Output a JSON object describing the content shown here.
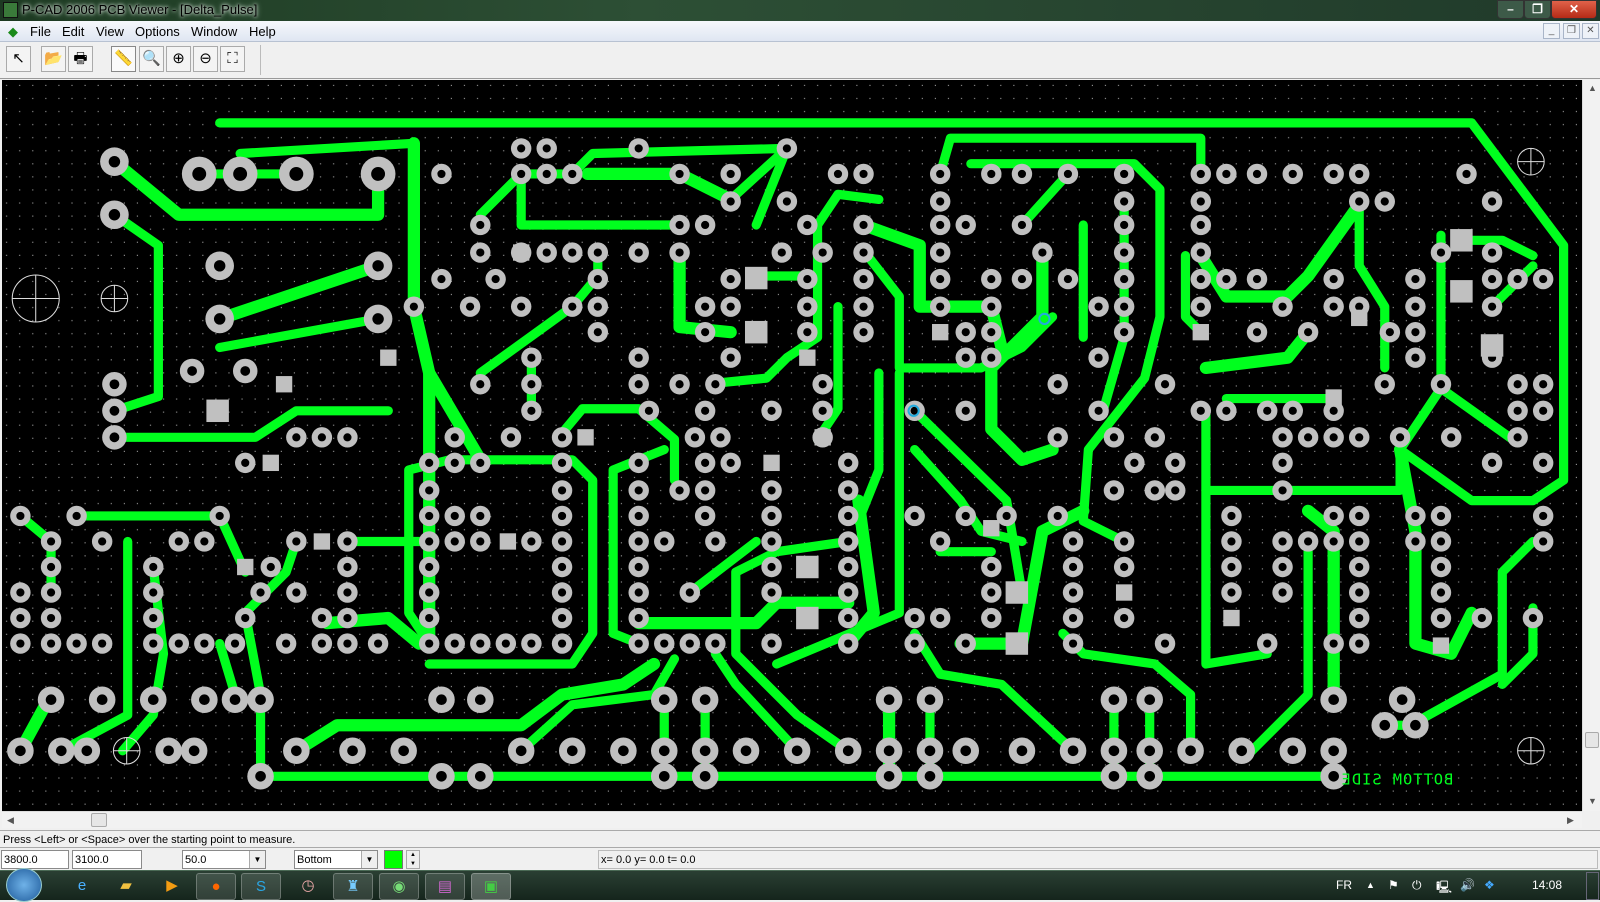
{
  "window": {
    "title": "P-CAD 2006 PCB Viewer - [Delta_Pulse]"
  },
  "menu": [
    "File",
    "Edit",
    "View",
    "Options",
    "Window",
    "Help"
  ],
  "toolbar": [
    {
      "name": "select-tool",
      "icon": "arrow-pointer-icon",
      "glyph": "↖"
    },
    {
      "name": "open-button",
      "icon": "folder-open-icon",
      "glyph": "📂"
    },
    {
      "name": "print-button",
      "icon": "printer-icon",
      "glyph": "🖶"
    },
    {
      "name": "measure-tool",
      "icon": "ruler-icon",
      "glyph": "📏"
    },
    {
      "name": "zoom-window-button",
      "icon": "zoom-window-icon",
      "glyph": "🔍"
    },
    {
      "name": "zoom-in-button",
      "icon": "zoom-in-icon",
      "glyph": "⊕"
    },
    {
      "name": "zoom-out-button",
      "icon": "zoom-out-icon",
      "glyph": "⊖"
    },
    {
      "name": "zoom-extents-button",
      "icon": "zoom-extents-icon",
      "glyph": "⛶"
    }
  ],
  "board": {
    "layer_label": "BOTTOM SIDE",
    "trace_color": "#00ff1e",
    "pad_color": "#c0c0c0",
    "background": "#000000"
  },
  "status": {
    "message": "Press <Left> or <Space> over the starting point to measure."
  },
  "fields": {
    "x": "3800.0",
    "y": "3100.0",
    "grid": "50.0",
    "layer": "Bottom",
    "layer_color": "#00ff00",
    "coords": "x=  0.0 y=  0.0 t=  0.0"
  },
  "taskbar": {
    "language": "FR",
    "time": "14:08"
  }
}
